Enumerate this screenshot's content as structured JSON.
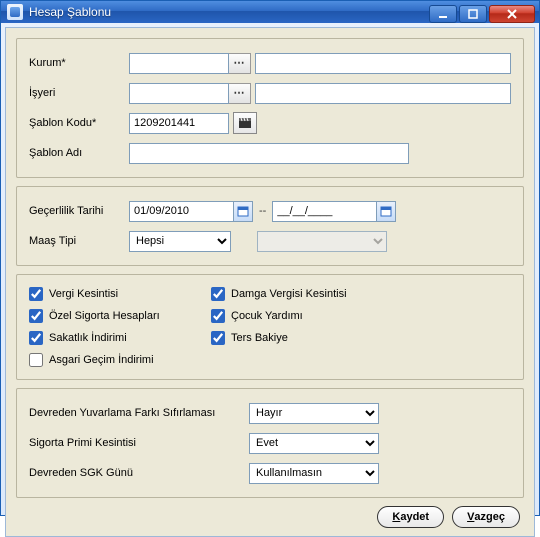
{
  "window": {
    "title": "Hesap Şablonu"
  },
  "group1": {
    "kurum_label": "Kurum*",
    "kurum_value": "",
    "kurum_desc": "",
    "isyeri_label": "İşyeri",
    "isyeri_value": "",
    "isyeri_desc": "",
    "sablon_kodu_label": "Şablon Kodu*",
    "sablon_kodu_value": "1209201441",
    "sablon_adi_label": "Şablon Adı",
    "sablon_adi_value": ""
  },
  "group2": {
    "gecerlilik_label": "Geçerlilik Tarihi",
    "date_from": "01/09/2010",
    "date_sep": "--",
    "date_to": "__/__/____",
    "maas_tipi_label": "Maaş Tipi",
    "maas_tipi_value": "Hepsi",
    "secondary_value": ""
  },
  "group3": {
    "chk1_label": "Vergi Kesintisi",
    "chk1": true,
    "chk2_label": "Damga Vergisi Kesintisi",
    "chk2": true,
    "chk3_label": "Özel Sigorta Hesapları",
    "chk3": true,
    "chk4_label": "Çocuk Yardımı",
    "chk4": true,
    "chk5_label": "Sakatlık İndirimi",
    "chk5": true,
    "chk6_label": "Ters Bakiye",
    "chk6": true,
    "chk7_label": "Asgari Geçim İndirimi",
    "chk7": false
  },
  "group4": {
    "opt1_label": "Devreden Yuvarlama Farkı Sıfırlaması",
    "opt1_value": "Hayır",
    "opt2_label": "Sigorta Primi Kesintisi",
    "opt2_value": "Evet",
    "opt3_label": "Devreden SGK Günü",
    "opt3_value": "Kullanılmasın"
  },
  "footer": {
    "save": "Kaydet",
    "cancel": "Vazgeç"
  }
}
